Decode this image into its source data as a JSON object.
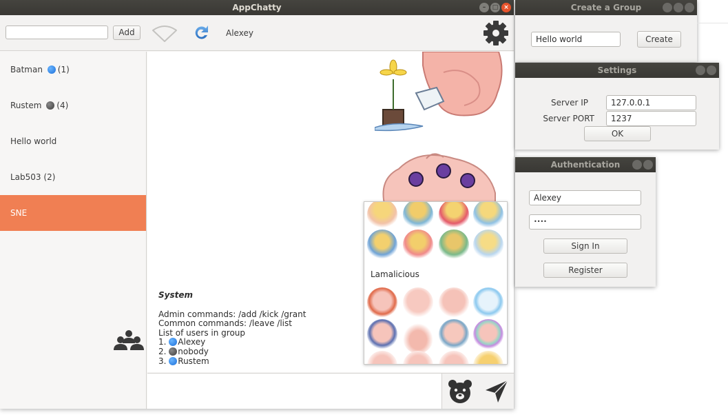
{
  "main_window": {
    "title": "AppChatty",
    "toolbar": {
      "search_value": "",
      "add_label": "Add",
      "current_user": "Alexey"
    },
    "chats": [
      {
        "name": "Batman",
        "status": "blue",
        "count": "(1)",
        "active": false
      },
      {
        "name": "Rustem",
        "status": "grey",
        "count": "(4)",
        "active": false
      },
      {
        "name": "Hello world",
        "status": "",
        "count": "",
        "active": false
      },
      {
        "name": "Lab503",
        "status": "",
        "count": "(2)",
        "active": false
      },
      {
        "name": "SNE",
        "status": "",
        "count": "",
        "active": true
      }
    ],
    "message": {
      "sender": "System",
      "lines": [
        "Admin commands: /add /kick /grant",
        "Common commands: /leave /list",
        "List of users in group"
      ],
      "users": [
        {
          "num": "1.",
          "status": "blue",
          "name": "Alexey"
        },
        {
          "num": "2.",
          "status": "grey",
          "name": "nobody"
        },
        {
          "num": "3.",
          "status": "blue",
          "name": "Rustem"
        }
      ]
    },
    "sticker_panel": {
      "section_label": "Lamalicious"
    },
    "colors": {
      "accent": "#f07f53",
      "titlebar": "#3c3b37",
      "close": "#e8542c"
    }
  },
  "create_group": {
    "title": "Create a Group",
    "name_value": "Hello world",
    "create_label": "Create"
  },
  "settings": {
    "title": "Settings",
    "server_ip_label": "Server IP",
    "server_ip_value": "127.0.0.1",
    "server_port_label": "Server PORT",
    "server_port_value": "1237",
    "ok_label": "OK"
  },
  "authentication": {
    "title": "Authentication",
    "username_value": "Alexey",
    "password_value": "••••",
    "signin_label": "Sign In",
    "register_label": "Register"
  }
}
